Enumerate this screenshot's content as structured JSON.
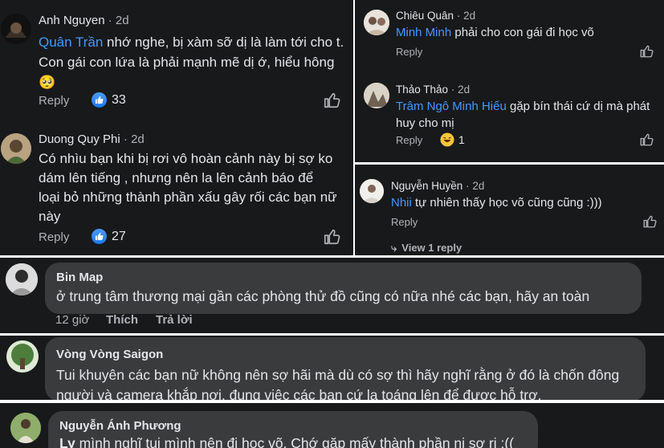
{
  "left_panel": {
    "c1": {
      "author": "Anh Nguyen",
      "time": "2d",
      "mention": "Quân Trần",
      "text": " nhớ nghe, bị xàm sỡ dị là làm tới cho t. Con gái con lứa là phải mạnh mẽ dị ớ, hiểu hông ",
      "emoji": "🥺",
      "reply": "Reply",
      "like_count": "33"
    },
    "c2": {
      "author": "Duong Quy Phi",
      "time": "2d",
      "text": "Có nhìu bạn khi bị rơi vô hoàn cảnh này bị sợ ko dám lên tiếng , nhưng nên la lên cảnh báo để loại bỏ những thành phần xấu gây rối các bạn nữ này",
      "reply": "Reply",
      "like_count": "27"
    }
  },
  "right_panel": {
    "c1": {
      "author": "Chiêu Quân",
      "time": "2d",
      "mention": "Minh Minh",
      "text": " phải cho con gái đi học võ",
      "reply": "Reply"
    },
    "c2": {
      "author": "Thảo Thảo",
      "time": "2d",
      "mention": "Trâm Ngô Minh Hiếu",
      "text": " gặp bín thái cứ dị mà phát huy cho mị",
      "reply": "Reply",
      "react_count": "1"
    },
    "c3": {
      "author": "Nguyễn Huyền",
      "time": "2d",
      "mention": "Nhii",
      "text": " tự nhiên thấy học võ cũng cũng :)))",
      "reply": "Reply",
      "view_replies": "View 1 reply"
    }
  },
  "bottom": {
    "c1": {
      "author": "Bin Map",
      "text": "ở trung tâm thương mại gần các phòng thử đồ cũng có nữa nhé các bạn, hãy an toàn",
      "time": "12 giờ",
      "like": "Thích",
      "reply": "Trả lời"
    },
    "c2": {
      "author": "Vòng Vòng Saigon",
      "text": "Tui khuyên các bạn nữ không nên sợ hãi mà dù có sợ thì hãy nghĩ rằng ở đó là chốn đông người và camera khắp nơi, đụng việc các bạn cứ la toáng lên để được hỗ trợ."
    },
    "c3": {
      "author": "Nguyễn Ánh Phương",
      "mention": "Ly",
      "text": " mình nghĩ tụi mình nên đi học võ. Chớ gặp mấy thành phần ni sợ rị :(("
    }
  },
  "colors": {
    "background": "#18191a",
    "bubble": "#3a3b3c",
    "text": "#e4e6eb",
    "muted": "#b0b3b8",
    "mention": "#4599ff",
    "like_blue": "#1877f2"
  }
}
